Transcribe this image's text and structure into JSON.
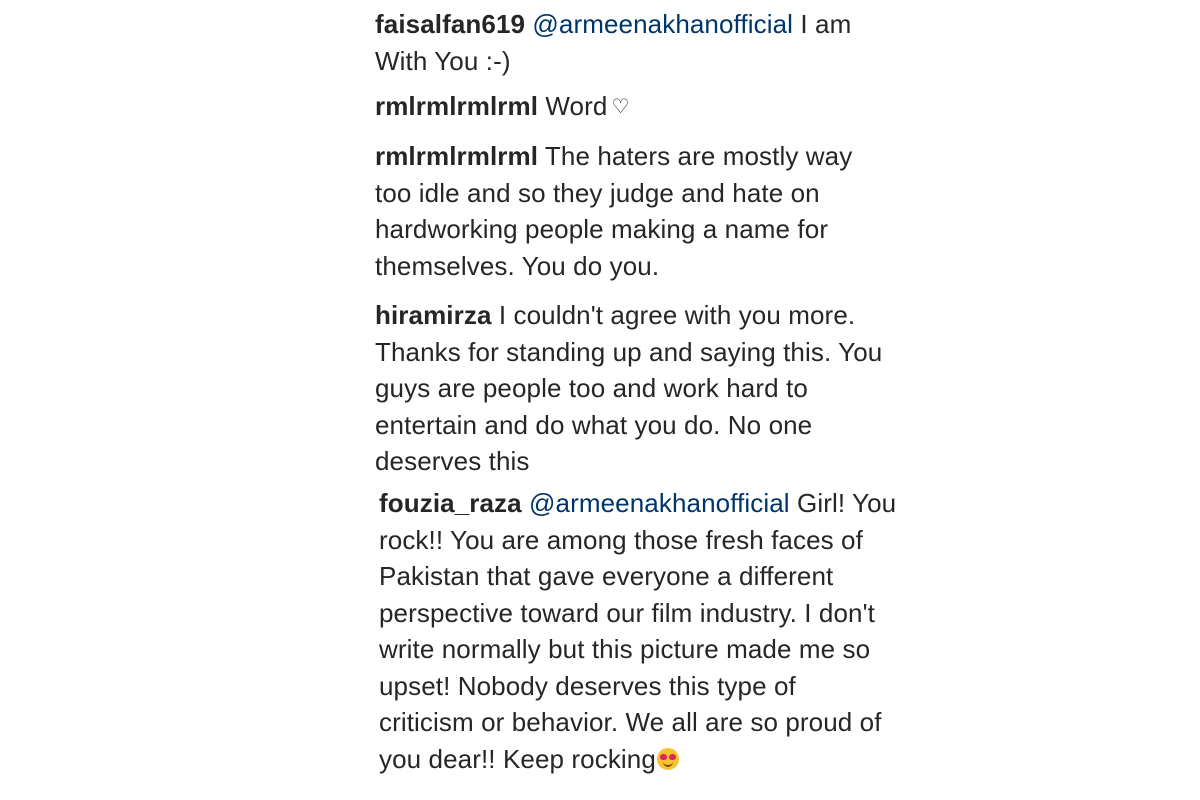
{
  "comments": [
    {
      "username": "faisalfan619",
      "mention": "@armeenakhanofficial",
      "lines": [
        "I am",
        "With You :-)"
      ]
    },
    {
      "username": "rmlrmlrmlrml",
      "lines": [
        "Word"
      ],
      "icon": "heart-icon"
    },
    {
      "username": "rmlrmlrmlrml",
      "lines": [
        "The haters are mostly way",
        "too idle and so they judge and hate on",
        "hardworking people making a name for",
        "themselves. You do you."
      ]
    },
    {
      "username": "hiramirza",
      "lines": [
        "I couldn't agree with you more.",
        "Thanks for standing up and saying this. You",
        "guys are people too and work hard to",
        "entertain and do what you do. No one",
        "deserves this"
      ]
    },
    {
      "username": "fouzia_raza",
      "mention": "@armeenakhanofficial",
      "lines": [
        "Girl! You",
        "rock!! You are among those fresh faces of",
        "Pakistan that gave everyone a different",
        "perspective toward our film industry. I don't",
        "write normally but this picture made me so",
        "upset! Nobody deserves this type of",
        "criticism or behavior. We all are so proud of",
        "you dear!! Keep rocking"
      ],
      "icon": "smiling-face-with-heart-eyes-icon"
    }
  ]
}
